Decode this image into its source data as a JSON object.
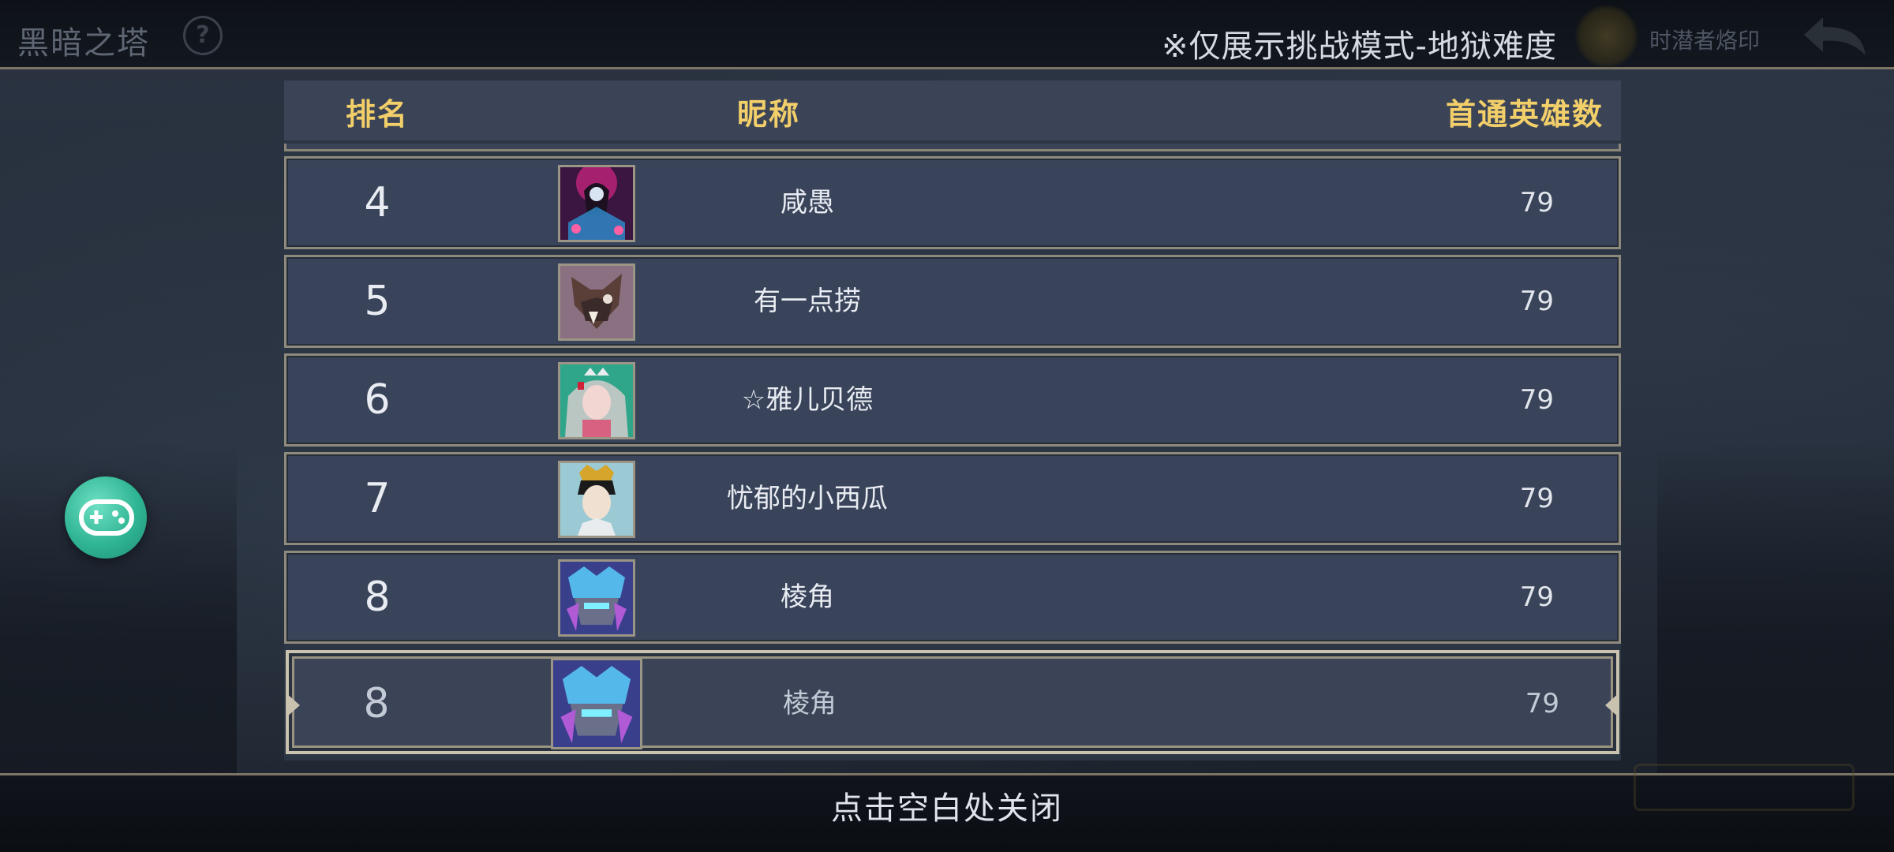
{
  "topbar": {
    "game_title": "黑暗之塔",
    "help_icon": "question-icon",
    "notice": "※仅展示挑战模式-地狱难度",
    "emblem_label": "时潜者烙印",
    "back_icon": "back-arrow-icon"
  },
  "ranking": {
    "headers": {
      "rank": "排名",
      "nickname": "昵称",
      "first_clear_heroes": "首通英雄数"
    },
    "rows": [
      {
        "rank": "4",
        "nickname": "咸愚",
        "count": "79",
        "avatar": "avatar-dark-mage"
      },
      {
        "rank": "5",
        "nickname": "有一点捞",
        "count": "79",
        "avatar": "avatar-hooded-beast"
      },
      {
        "rank": "6",
        "nickname": "☆雅儿贝德",
        "count": "79",
        "avatar": "avatar-silver-hair-girl"
      },
      {
        "rank": "7",
        "nickname": "忧郁的小西瓜",
        "count": "79",
        "avatar": "avatar-crowned-hero"
      },
      {
        "rank": "8",
        "nickname": "棱角",
        "count": "79",
        "avatar": "avatar-blue-armor"
      }
    ],
    "self_row": {
      "rank": "8",
      "nickname": "棱角",
      "count": "79",
      "avatar": "avatar-blue-armor"
    }
  },
  "footer": {
    "close_hint": "点击空白处关闭"
  },
  "floating": {
    "gamepad_icon": "gamepad-icon"
  },
  "colors": {
    "header_text": "#f3cf6a",
    "row_bg": "#39445a",
    "row_border": "#8f8a7e",
    "gamepad_green": "#2fb593"
  }
}
